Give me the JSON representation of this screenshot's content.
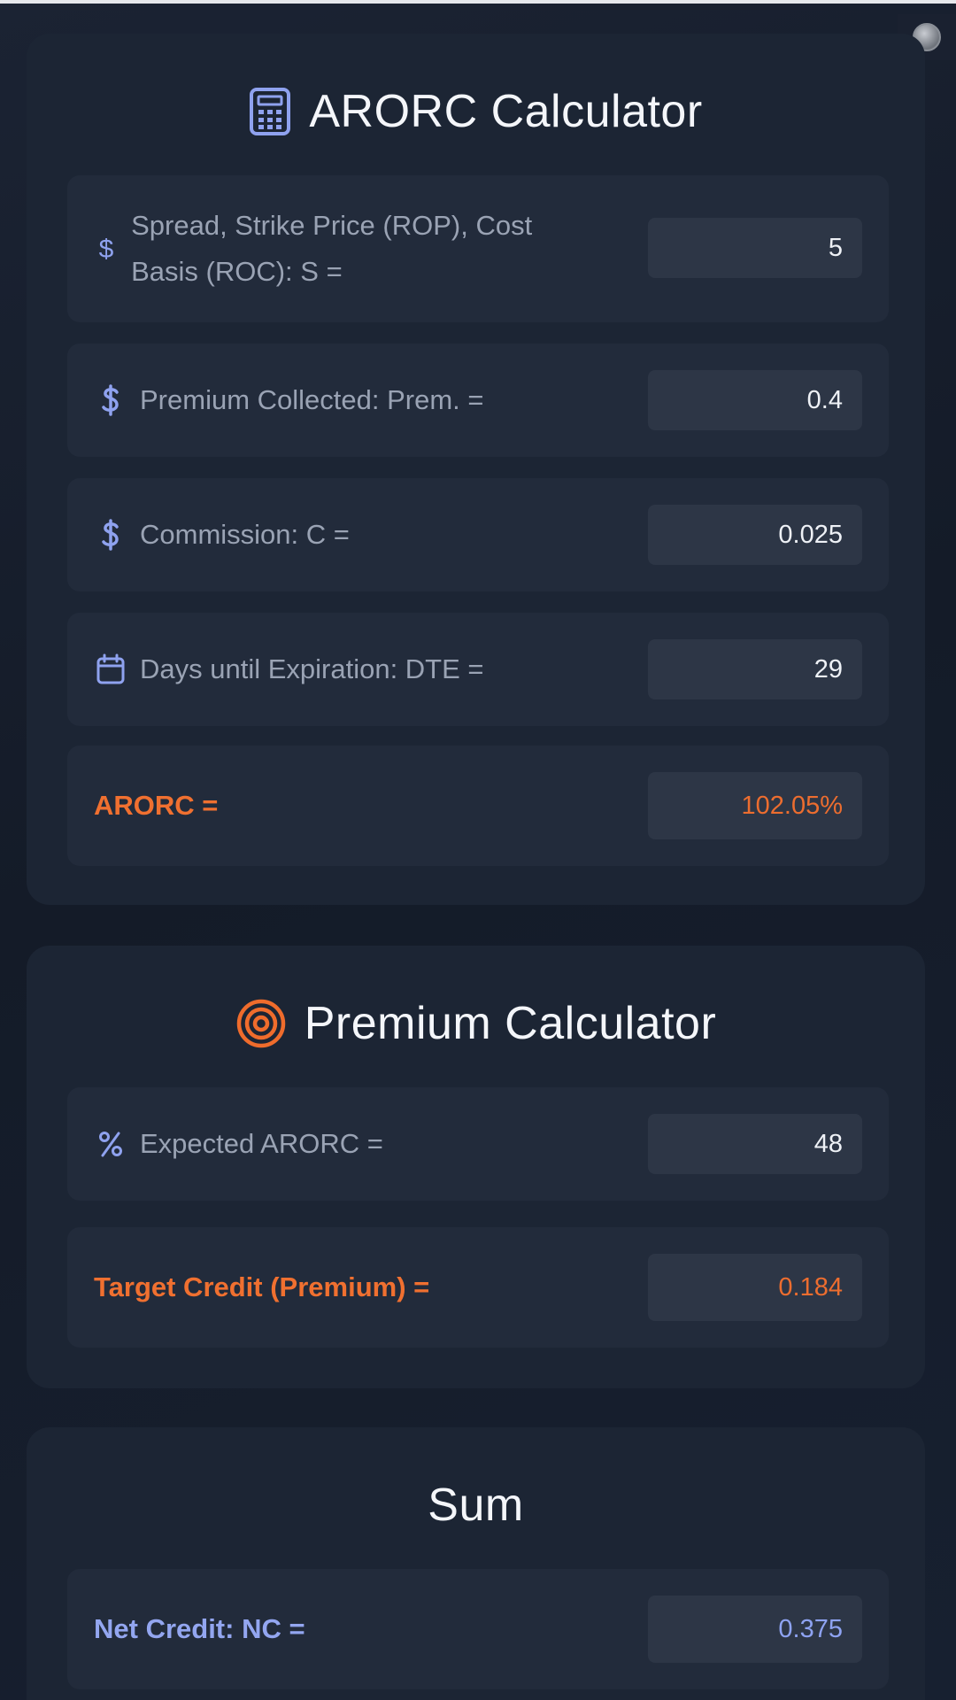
{
  "arorc_calculator": {
    "title": "ARORC Calculator",
    "rows": [
      {
        "label": "Spread, Strike Price (ROP), Cost Basis (ROC): S =",
        "value": "5"
      },
      {
        "label": "Premium Collected: Prem. =",
        "value": "0.4"
      },
      {
        "label": "Commission: C =",
        "value": "0.025"
      },
      {
        "label": "Days until Expiration: DTE =",
        "value": "29"
      }
    ],
    "result": {
      "label": "ARORC =",
      "value": "102.05%"
    }
  },
  "premium_calculator": {
    "title": "Premium Calculator",
    "rows": [
      {
        "label": "Expected ARORC =",
        "value": "48"
      }
    ],
    "result": {
      "label": "Target Credit (Premium) =",
      "value": "0.184"
    }
  },
  "sum": {
    "title": "Sum",
    "result": {
      "label": "Net Credit: NC =",
      "value": "0.375"
    }
  },
  "colors": {
    "accent_orange": "#F07030",
    "accent_blue": "#93A6F0",
    "background": "#151C2A"
  }
}
